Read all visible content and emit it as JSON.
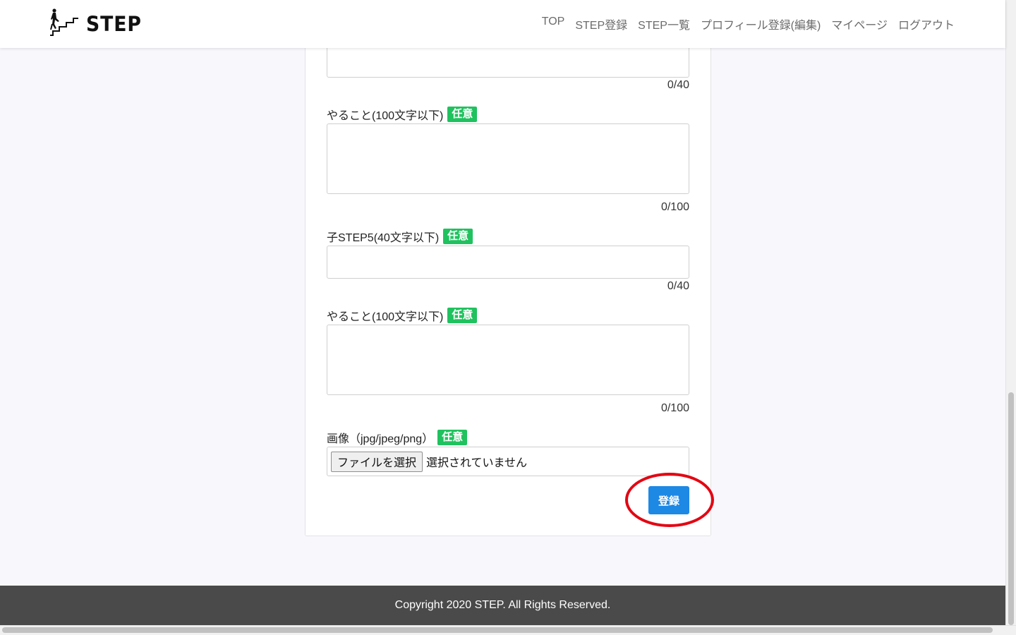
{
  "header": {
    "logo_text": "STEP",
    "nav": [
      {
        "label": "TOP"
      },
      {
        "label": "STEP登録"
      },
      {
        "label": "STEP一覧"
      },
      {
        "label": "プロフィール登録(編集)"
      },
      {
        "label": "マイページ"
      },
      {
        "label": "ログアウト"
      }
    ]
  },
  "form": {
    "step4_title": {
      "value": "",
      "counter": "0/40"
    },
    "step4_todo": {
      "label": "やること(100文字以下)",
      "badge": "任意",
      "value": "",
      "counter": "0/100"
    },
    "step5_title": {
      "label": "子STEP5(40文字以下)",
      "badge": "任意",
      "value": "",
      "counter": "0/40"
    },
    "step5_todo": {
      "label": "やること(100文字以下)",
      "badge": "任意",
      "value": "",
      "counter": "0/100"
    },
    "image": {
      "label": "画像（jpg/jpeg/png）",
      "badge": "任意",
      "button_label": "ファイルを選択",
      "status": "選択されていません"
    },
    "submit_label": "登録"
  },
  "footer": {
    "copyright": "Copyright 2020 STEP. All Rights Reserved."
  },
  "colors": {
    "accent_blue": "#1e88e5",
    "badge_green": "#1fc25e",
    "highlight_red": "#e30613",
    "footer_bg": "#4a4a4a"
  },
  "icons": {
    "logo": "stairs-climber-icon"
  }
}
